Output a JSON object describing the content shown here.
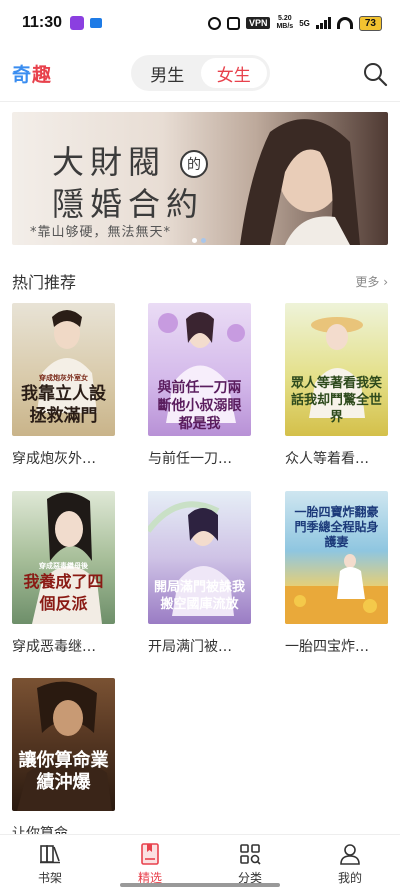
{
  "status_bar": {
    "time": "11:30",
    "vpn": "VPN",
    "speed_value": "5.20",
    "speed_unit": "MB/s",
    "network": "5G",
    "battery": "73"
  },
  "header": {
    "logo_part1": "奇",
    "logo_part2": "趣",
    "tabs": [
      {
        "label": "男生",
        "active": false
      },
      {
        "label": "女生",
        "active": true
      }
    ],
    "search_icon": "search-icon"
  },
  "banner": {
    "title_line1": "大財閥",
    "title_de": "的",
    "title_line2": "隱婚合約",
    "tagline": "*靠山够硬，無法無天*",
    "active_slide": 1,
    "slide_count": 2
  },
  "section": {
    "title": "热门推荐",
    "more_label": "更多 ›"
  },
  "books": [
    {
      "title": "穿成炮灰外…",
      "cover_text": "我靠立人設拯救滿門",
      "cover_subtitle": "穿成炮灰外室女",
      "colors": [
        "#e8e3d6",
        "#c9b48a"
      ]
    },
    {
      "title": "与前任一刀…",
      "cover_text": "與前任一刀兩斷他小叔溺眼都是我",
      "cover_subtitle": "",
      "colors": [
        "#e4d0ef",
        "#b891d6"
      ]
    },
    {
      "title": "众人等着看…",
      "cover_text": "眾人等著看我笑話我却鬥驚全世界",
      "cover_subtitle": "",
      "colors": [
        "#e9f0c9",
        "#d4c04a"
      ]
    },
    {
      "title": "穿成恶毒继…",
      "cover_text": "我養成了四個反派",
      "cover_subtitle": "穿成惡毒繼母後",
      "colors": [
        "#dfe8d6",
        "#6e8f6a"
      ]
    },
    {
      "title": "开局满门被…",
      "cover_text": "開局滿門被誅我搬空國庫流放",
      "cover_subtitle": "",
      "colors": [
        "#d8cfe8",
        "#9a7cc4"
      ]
    },
    {
      "title": "一胎四宝炸…",
      "cover_text": "一胎四寶炸翻豪門季總全程貼身護妻",
      "cover_subtitle": "",
      "colors": [
        "#cfe6f0",
        "#f0b63e"
      ]
    },
    {
      "title": "让你算命…",
      "cover_text": "讓你算命業績沖爆",
      "cover_subtitle": "",
      "colors": [
        "#5a3a24",
        "#2a1a10"
      ]
    }
  ],
  "bottom_nav": [
    {
      "label": "书架",
      "icon": "bookshelf-icon",
      "active": false
    },
    {
      "label": "精选",
      "icon": "featured-book-icon",
      "active": true
    },
    {
      "label": "分类",
      "icon": "category-grid-icon",
      "active": false
    },
    {
      "label": "我的",
      "icon": "profile-icon",
      "active": false
    }
  ],
  "colors": {
    "accent": "#e8414c",
    "logo_blue": "#3a8df0"
  }
}
